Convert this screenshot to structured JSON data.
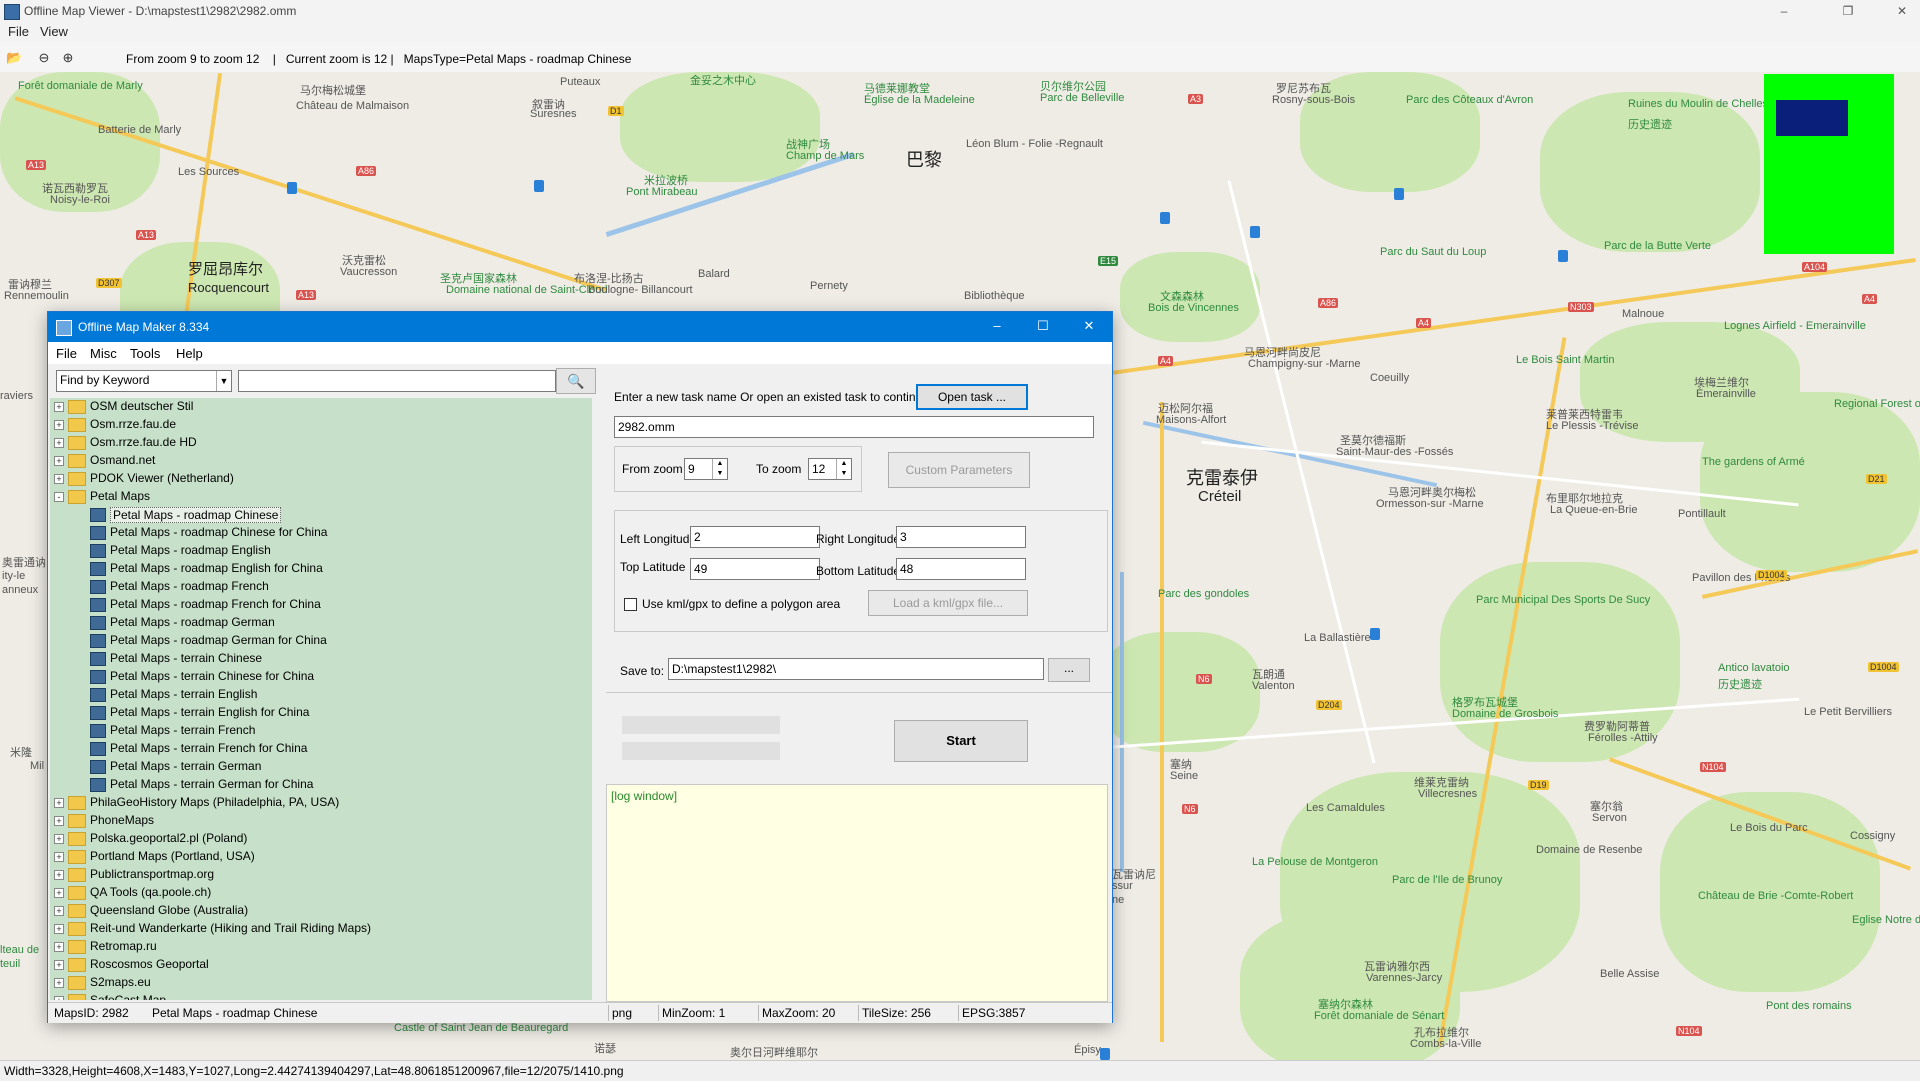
{
  "viewer": {
    "title": "Offline Map Viewer - D:\\mapstest1\\2982\\2982.omm",
    "menu": [
      "File",
      "View"
    ],
    "toolbar_status": "From zoom 9 to zoom 12    |   Current zoom is 12 |   MapsType=Petal Maps - roadmap Chinese",
    "icons": [
      "folder-open-icon",
      "zoom-out-icon",
      "zoom-in-icon"
    ],
    "status": "Width=3328,Height=4608,X=1483,Y=1027,Long=2.44274139404297,Lat=48.8061851200967,file=12/2075/1410.png"
  },
  "map": {
    "labels": [
      {
        "text": "Forêt domaniale de Marly",
        "kind": "park"
      },
      {
        "text": "马尔梅松城堡",
        "kind": "place"
      },
      {
        "text": "Château de Malmaison",
        "kind": "place"
      },
      {
        "text": "叙雷讷",
        "kind": "place"
      },
      {
        "text": "Suresnes",
        "kind": "place"
      },
      {
        "text": "金妥之木中心",
        "kind": "park"
      },
      {
        "text": "马德莱娜教堂",
        "kind": "park"
      },
      {
        "text": "Église de la Madeleine",
        "kind": "park"
      },
      {
        "text": "贝尔维尔公园",
        "kind": "park"
      },
      {
        "text": "Parc de Belleville",
        "kind": "park"
      },
      {
        "text": "罗尼苏布瓦",
        "kind": "place"
      },
      {
        "text": "Rosny-sous-Bois",
        "kind": "place"
      },
      {
        "text": "Parc des Côteaux d'Avron",
        "kind": "park"
      },
      {
        "text": "Ruines du Moulin de Chelles",
        "kind": "park"
      },
      {
        "text": "历史遗迹",
        "kind": "park"
      },
      {
        "text": "Batterie de Marly",
        "kind": "place"
      },
      {
        "text": "战神广场",
        "kind": "park"
      },
      {
        "text": "Champ de Mars",
        "kind": "park"
      },
      {
        "text": "巴黎",
        "kind": "city"
      },
      {
        "text": "Léon Blum - Folie -Regnault",
        "kind": "place"
      },
      {
        "text": "Les Sources",
        "kind": "place"
      },
      {
        "text": "米拉波桥",
        "kind": "park"
      },
      {
        "text": "Pont Mirabeau",
        "kind": "park"
      },
      {
        "text": "诺瓦西勒罗瓦",
        "kind": "place"
      },
      {
        "text": "Noisy-le-Roi",
        "kind": "place"
      },
      {
        "text": "Parc du Saut du Loup",
        "kind": "park"
      },
      {
        "text": "Parc de la Butte Verte",
        "kind": "park"
      },
      {
        "text": "罗屈昂库尔",
        "kind": "city"
      },
      {
        "text": "Rocquencourt",
        "kind": "city"
      },
      {
        "text": "沃克雷松",
        "kind": "place"
      },
      {
        "text": "Vaucresson",
        "kind": "place"
      },
      {
        "text": "圣克卢国家森林",
        "kind": "park"
      },
      {
        "text": "Domaine national de Saint-Cloud",
        "kind": "park"
      },
      {
        "text": "布洛涅-比扬古",
        "kind": "place"
      },
      {
        "text": "Boulogne- Billancourt",
        "kind": "place"
      },
      {
        "text": "Balard",
        "kind": "place"
      },
      {
        "text": "Pernety",
        "kind": "place"
      },
      {
        "text": "Bibliothèque",
        "kind": "place"
      },
      {
        "text": "文森森林",
        "kind": "park"
      },
      {
        "text": "Bois de Vincennes",
        "kind": "park"
      },
      {
        "text": "Malnoue",
        "kind": "place"
      },
      {
        "text": "Lognes Airfield - Emerainville",
        "kind": "place"
      },
      {
        "text": "雷讷穆兰",
        "kind": "place"
      },
      {
        "text": "Rennemoulin",
        "kind": "place"
      },
      {
        "text": "马恩河畔尚皮尼",
        "kind": "place"
      },
      {
        "text": "Champigny-sur -Marne",
        "kind": "place"
      },
      {
        "text": "Le Bois Saint Martin",
        "kind": "park"
      },
      {
        "text": "埃梅兰维尔",
        "kind": "place"
      },
      {
        "text": "Émerainville",
        "kind": "place"
      },
      {
        "text": "Regional Forest of Ferrières",
        "kind": "park"
      },
      {
        "text": "迈松阿尔福",
        "kind": "place"
      },
      {
        "text": "Maisons-Alfort",
        "kind": "place"
      },
      {
        "text": "Coeuilly",
        "kind": "place"
      },
      {
        "text": "莱普莱西特雷韦",
        "kind": "place"
      },
      {
        "text": "Le Plessis -Trévise",
        "kind": "place"
      },
      {
        "text": "克雷泰伊",
        "kind": "city"
      },
      {
        "text": "Créteil",
        "kind": "city"
      },
      {
        "text": "圣莫尔德福斯",
        "kind": "place"
      },
      {
        "text": "Saint-Maur-des -Fossés",
        "kind": "place"
      },
      {
        "text": "The gardens of Armé",
        "kind": "park"
      },
      {
        "text": "马恩河畔奥尔梅松",
        "kind": "place"
      },
      {
        "text": "Ormesson-sur -Marne",
        "kind": "place"
      },
      {
        "text": "布里耶尔地拉克",
        "kind": "place"
      },
      {
        "text": "La Queue-en-Brie",
        "kind": "place"
      },
      {
        "text": "Pontillault",
        "kind": "place"
      },
      {
        "text": "Pavillon des Friches",
        "kind": "place"
      },
      {
        "text": "Parc des gondoles",
        "kind": "park"
      },
      {
        "text": "Parc Municipal Des Sports De Sucy",
        "kind": "park"
      },
      {
        "text": "La Ballastière",
        "kind": "place"
      },
      {
        "text": "瓦朗通",
        "kind": "place"
      },
      {
        "text": "Valenton",
        "kind": "place"
      },
      {
        "text": "格罗布瓦城堡",
        "kind": "park"
      },
      {
        "text": "Domaine de Grosbois",
        "kind": "park"
      },
      {
        "text": "Antico lavatoio",
        "kind": "park"
      },
      {
        "text": "历史遗迹",
        "kind": "park"
      },
      {
        "text": "费罗勒阿蒂普",
        "kind": "place"
      },
      {
        "text": "Férolles -Attily",
        "kind": "place"
      },
      {
        "text": "Le Petit Bervilliers",
        "kind": "place"
      },
      {
        "text": "维莱克雷纳",
        "kind": "place"
      },
      {
        "text": "Villecresnes",
        "kind": "place"
      },
      {
        "text": "Les Camaldules",
        "kind": "place"
      },
      {
        "text": "塞尔翁",
        "kind": "place"
      },
      {
        "text": "Servon",
        "kind": "place"
      },
      {
        "text": "Le Bois du Parc",
        "kind": "place"
      },
      {
        "text": "Cossigny",
        "kind": "place"
      },
      {
        "text": "Domaine de Resenbe",
        "kind": "place"
      },
      {
        "text": "La Pelouse de Montgeron",
        "kind": "park"
      },
      {
        "text": "Parc de l'Ile de Brunoy",
        "kind": "park"
      },
      {
        "text": "Château de Brie -Comte-Robert",
        "kind": "park"
      },
      {
        "text": "Eglise Notre des Roses",
        "kind": "park"
      },
      {
        "text": "瓦雷讷雅尔西",
        "kind": "place"
      },
      {
        "text": "Varennes-Jarcy",
        "kind": "place"
      },
      {
        "text": "Belle Assise",
        "kind": "place"
      },
      {
        "text": "塞纳尔森林",
        "kind": "park"
      },
      {
        "text": "Forêt domaniale de Sénart",
        "kind": "park"
      },
      {
        "text": "孔布拉维尔",
        "kind": "place"
      },
      {
        "text": "Combs-la-Ville",
        "kind": "place"
      },
      {
        "text": "Pont des romains",
        "kind": "park"
      },
      {
        "text": "诺瑟",
        "kind": "place"
      },
      {
        "text": "奥尔日河畔维耶尔",
        "kind": "place"
      },
      {
        "text": "Épisy",
        "kind": "place"
      },
      {
        "text": "Castle of Saint Jean de Beauregard",
        "kind": "park"
      },
      {
        "text": "Puteaux",
        "kind": "place"
      },
      {
        "text": "raviers",
        "kind": "place"
      },
      {
        "text": "米隆",
        "kind": "place"
      },
      {
        "text": "Mil",
        "kind": "place"
      },
      {
        "text": "奥雷通讷",
        "kind": "place"
      },
      {
        "text": "ity-le",
        "kind": "place"
      },
      {
        "text": "anneux",
        "kind": "place"
      },
      {
        "text": "lteau de",
        "kind": "park"
      },
      {
        "text": "teuil",
        "kind": "park"
      },
      {
        "text": "塞纳",
        "kind": "place"
      },
      {
        "text": "Seine",
        "kind": "place"
      },
      {
        "text": "瓦雷讷尼",
        "kind": "place"
      },
      {
        "text": "ssur",
        "kind": "place"
      },
      {
        "text": "ne",
        "kind": "place"
      }
    ],
    "shields": [
      "A13",
      "A86",
      "A3",
      "D1",
      "A13",
      "D307",
      "A13",
      "E15",
      "A104",
      "A4",
      "A86",
      "A4",
      "N303",
      "A4",
      "N6",
      "D204",
      "N6",
      "D19",
      "N104",
      "D1004",
      "D21",
      "D1004",
      "N104"
    ]
  },
  "dialog": {
    "title": "Offline Map Maker 8.334",
    "menu": [
      "File",
      "Misc",
      "Tools",
      "Help"
    ],
    "find_by": "Find by Keyword",
    "search_value": "",
    "tree": [
      {
        "label": "OSM deutscher Stil",
        "level": 0,
        "exp": "+"
      },
      {
        "label": "Osm.rrze.fau.de",
        "level": 0,
        "exp": "+"
      },
      {
        "label": "Osm.rrze.fau.de HD",
        "level": 0,
        "exp": "+"
      },
      {
        "label": "Osmand.net",
        "level": 0,
        "exp": "+"
      },
      {
        "label": "PDOK Viewer (Netherland)",
        "level": 0,
        "exp": "+"
      },
      {
        "label": "Petal Maps",
        "level": 0,
        "exp": "-"
      },
      {
        "label": "Petal Maps - roadmap Chinese",
        "level": 1,
        "selected": true
      },
      {
        "label": "Petal Maps - roadmap Chinese for China",
        "level": 1
      },
      {
        "label": "Petal Maps - roadmap English",
        "level": 1
      },
      {
        "label": "Petal Maps - roadmap English for China",
        "level": 1
      },
      {
        "label": "Petal Maps - roadmap French",
        "level": 1
      },
      {
        "label": "Petal Maps - roadmap French for China",
        "level": 1
      },
      {
        "label": "Petal Maps - roadmap German",
        "level": 1
      },
      {
        "label": "Petal Maps - roadmap German for China",
        "level": 1
      },
      {
        "label": "Petal Maps - terrain Chinese",
        "level": 1
      },
      {
        "label": "Petal Maps - terrain Chinese for China",
        "level": 1
      },
      {
        "label": "Petal Maps - terrain English",
        "level": 1
      },
      {
        "label": "Petal Maps - terrain English for China",
        "level": 1
      },
      {
        "label": "Petal Maps - terrain French",
        "level": 1
      },
      {
        "label": "Petal Maps - terrain French for China",
        "level": 1
      },
      {
        "label": "Petal Maps - terrain German",
        "level": 1
      },
      {
        "label": "Petal Maps - terrain German for China",
        "level": 1
      },
      {
        "label": "PhilaGeoHistory Maps (Philadelphia, PA, USA)",
        "level": 0,
        "exp": "+"
      },
      {
        "label": "PhoneMaps",
        "level": 0,
        "exp": "+"
      },
      {
        "label": "Polska.geoportal2.pl (Poland)",
        "level": 0,
        "exp": "+"
      },
      {
        "label": "Portland Maps (Portland, USA)",
        "level": 0,
        "exp": "+"
      },
      {
        "label": "Publictransportmap.org",
        "level": 0,
        "exp": "+"
      },
      {
        "label": "QA Tools (qa.poole.ch)",
        "level": 0,
        "exp": "+"
      },
      {
        "label": "Queensland Globe (Australia)",
        "level": 0,
        "exp": "+"
      },
      {
        "label": "Reit-und Wanderkarte (Hiking and Trail Riding Maps)",
        "level": 0,
        "exp": "+"
      },
      {
        "label": "Retromap.ru",
        "level": 0,
        "exp": "+"
      },
      {
        "label": "Roscosmos Geoportal",
        "level": 0,
        "exp": "+"
      },
      {
        "label": "S2maps.eu",
        "level": 0,
        "exp": "+"
      },
      {
        "label": "SafeCast Map",
        "level": 0,
        "exp": "+"
      }
    ],
    "task_prompt": "Enter a new task name Or open an existed task to continue:",
    "open_task_label": "Open task ...",
    "task_name": "2982.omm",
    "from_zoom_label": "From zoom",
    "from_zoom": "9",
    "to_zoom_label": "To zoom",
    "to_zoom": "12",
    "custom_params_label": "Custom Parameters",
    "left_lon_label": "Left Longitude",
    "left_lon": "2",
    "right_lon_label": "Right Longitude",
    "right_lon": "3",
    "top_lat_label": "Top Latitude",
    "top_lat": "49",
    "bottom_lat_label": "Bottom Latitude",
    "bottom_lat": "48",
    "kml_checkbox_label": "Use kml/gpx to define a polygon area",
    "kml_checked": false,
    "load_kml_label": "Load a kml/gpx file...",
    "save_to_label": "Save to:",
    "save_to": "D:\\mapstest1\\2982\\",
    "browse_label": "...",
    "start_label": "Start",
    "log_text": "[log window]",
    "status": {
      "maps_id": "MapsID: 2982",
      "maps_name": "Petal Maps - roadmap Chinese",
      "format": "png",
      "min_zoom": "MinZoom: 1",
      "max_zoom": "MaxZoom: 20",
      "tile_size": "TileSize: 256",
      "epsg": "EPSG:3857"
    }
  }
}
